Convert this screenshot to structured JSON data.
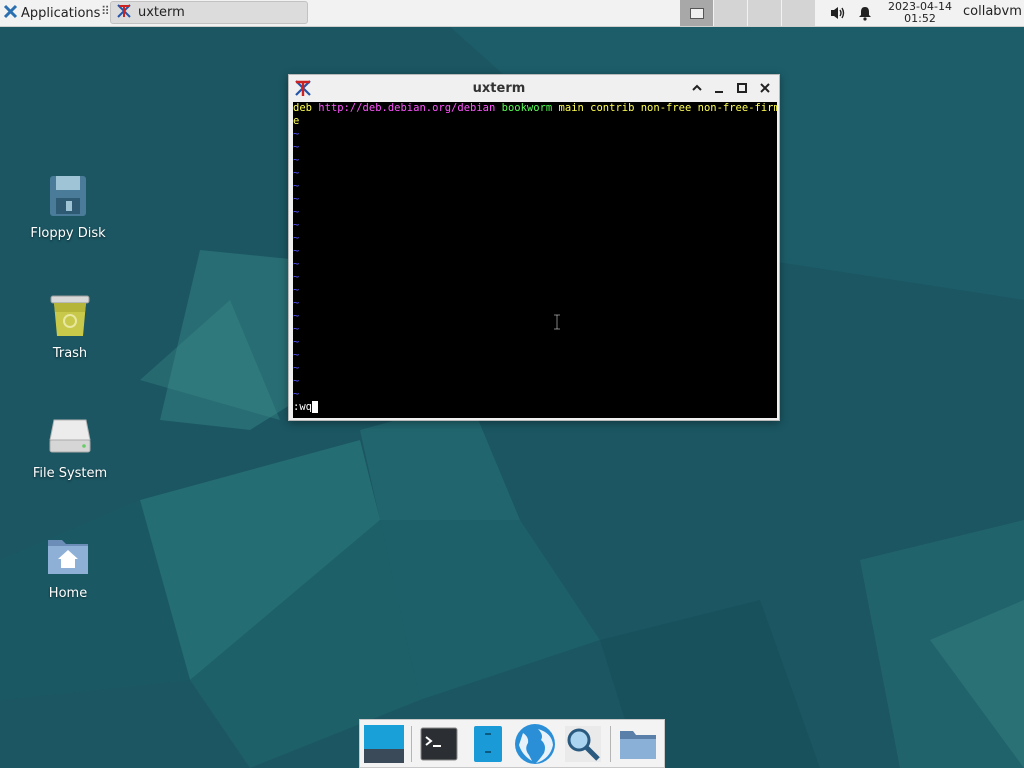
{
  "top_panel": {
    "applications_label": "Applications",
    "task_window_title": "uxterm",
    "clock_date": "2023-04-14",
    "clock_time": "01:52",
    "username": "collabvm"
  },
  "desktop_icons": [
    {
      "name": "Floppy Disk"
    },
    {
      "name": "Trash"
    },
    {
      "name": "File System"
    },
    {
      "name": "Home"
    }
  ],
  "window": {
    "title": "uxterm",
    "terminal": {
      "line1": {
        "w1": "deb",
        "w2": "http://deb.debian.org/debian",
        "w3": "bookworm",
        "w4": "main contrib non-free non-free-firmwar"
      },
      "line2": "e",
      "tilde": "~",
      "command": ":wq"
    }
  },
  "colors": {
    "terminal_bg": "#000000",
    "keyword_yellow": "#ffff55",
    "url_magenta": "#ff55ff",
    "suite_green": "#55ff55",
    "tilde_blue": "#5555ff",
    "desktop_teal": "#1c5a66",
    "panel_bg": "#f2f2f2"
  },
  "dock": [
    {
      "icon": "show-desktop-icon"
    },
    {
      "icon": "terminal-icon"
    },
    {
      "icon": "file-manager-icon"
    },
    {
      "icon": "web-browser-icon"
    },
    {
      "icon": "app-finder-icon"
    },
    {
      "icon": "folder-icon"
    }
  ]
}
